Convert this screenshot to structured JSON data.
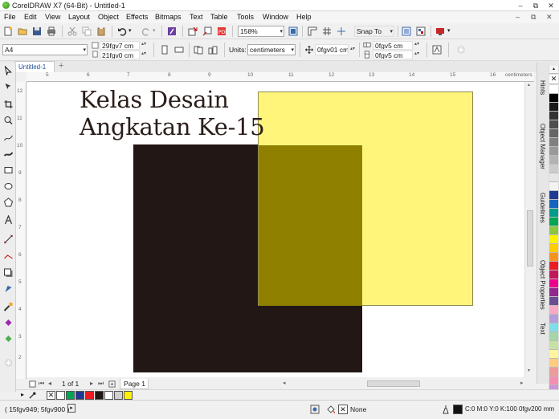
{
  "window": {
    "title": "CorelDRAW X7 (64-Bit) - Untitled-1",
    "controls": [
      "–",
      "⧉",
      "✕"
    ],
    "doc_controls": [
      "–",
      "⧉",
      "✕"
    ]
  },
  "menu": [
    "File",
    "Edit",
    "View",
    "Layout",
    "Object",
    "Effects",
    "Bitmaps",
    "Text",
    "Table",
    "Tools",
    "Window",
    "Help"
  ],
  "standard_toolbar": {
    "zoom": "158%",
    "snap_to": "Snap To"
  },
  "property_bar": {
    "page_size": "A4",
    "width": "29fgv7 cm",
    "height": "21fgv0 cm",
    "units_label": "Units:",
    "units": "centimeters",
    "nudge": "0fgv01 cm",
    "dup_x": "0fgv5 cm",
    "dup_y": "0fgv5 cm"
  },
  "document_tab": "Untitled-1",
  "ruler": {
    "unit_label": "centimeters",
    "h_ticks": [
      "5",
      "6",
      "7",
      "8",
      "9",
      "10",
      "11",
      "12",
      "13",
      "14",
      "15",
      "16",
      "17",
      "18"
    ],
    "v_ticks": [
      "12",
      "11",
      "10",
      "9",
      "8",
      "7",
      "6",
      "5",
      "4",
      "3",
      "2"
    ],
    "v_unit_label": "centimeters"
  },
  "canvas": {
    "text_line1": "Kelas Desain",
    "text_line2": "Angkatan Ke-15",
    "dark_rect_color": "#221714",
    "yellow_rect_color": "#fff57a",
    "overlap_color": "#8f8000"
  },
  "dockers": [
    "Hints",
    "Object Manager",
    "Guidelines",
    "Object Properties",
    "Text"
  ],
  "page_nav": {
    "page_count": "1 of 1",
    "page_tab": "Page 1"
  },
  "palette_colors": [
    "#ffffff",
    "#000000",
    "#1a1a1a",
    "#333333",
    "#4d4d4d",
    "#666666",
    "#808080",
    "#999999",
    "#b3b3b3",
    "#cccccc",
    "#e6e6e6",
    "#f2f2f2",
    "#1f3a93",
    "#1565c0",
    "#009b8d",
    "#00a651",
    "#8dc63f",
    "#fff200",
    "#ffcc00",
    "#f7941d",
    "#ed1c24",
    "#c2185b",
    "#ec008c",
    "#92278f",
    "#6a4c93",
    "#f9a8c6",
    "#b39ddb",
    "#80deea",
    "#a5d6a7",
    "#c5e1a5",
    "#fff59d",
    "#ffcc80",
    "#ef9a9a",
    "#f48fb1",
    "#ce93d8"
  ],
  "doc_palette": [
    "#ffffff",
    "#00a651",
    "#1f3a93",
    "#ed1c24",
    "#221714",
    "#ffffff",
    "#d0d0d0",
    "#fff200"
  ],
  "status": {
    "cursor": "( 15fgv949; 5fgv900 )",
    "fill": "None",
    "outline": "C:0 M:0 Y:0 K:100  0fgv200 mm"
  }
}
